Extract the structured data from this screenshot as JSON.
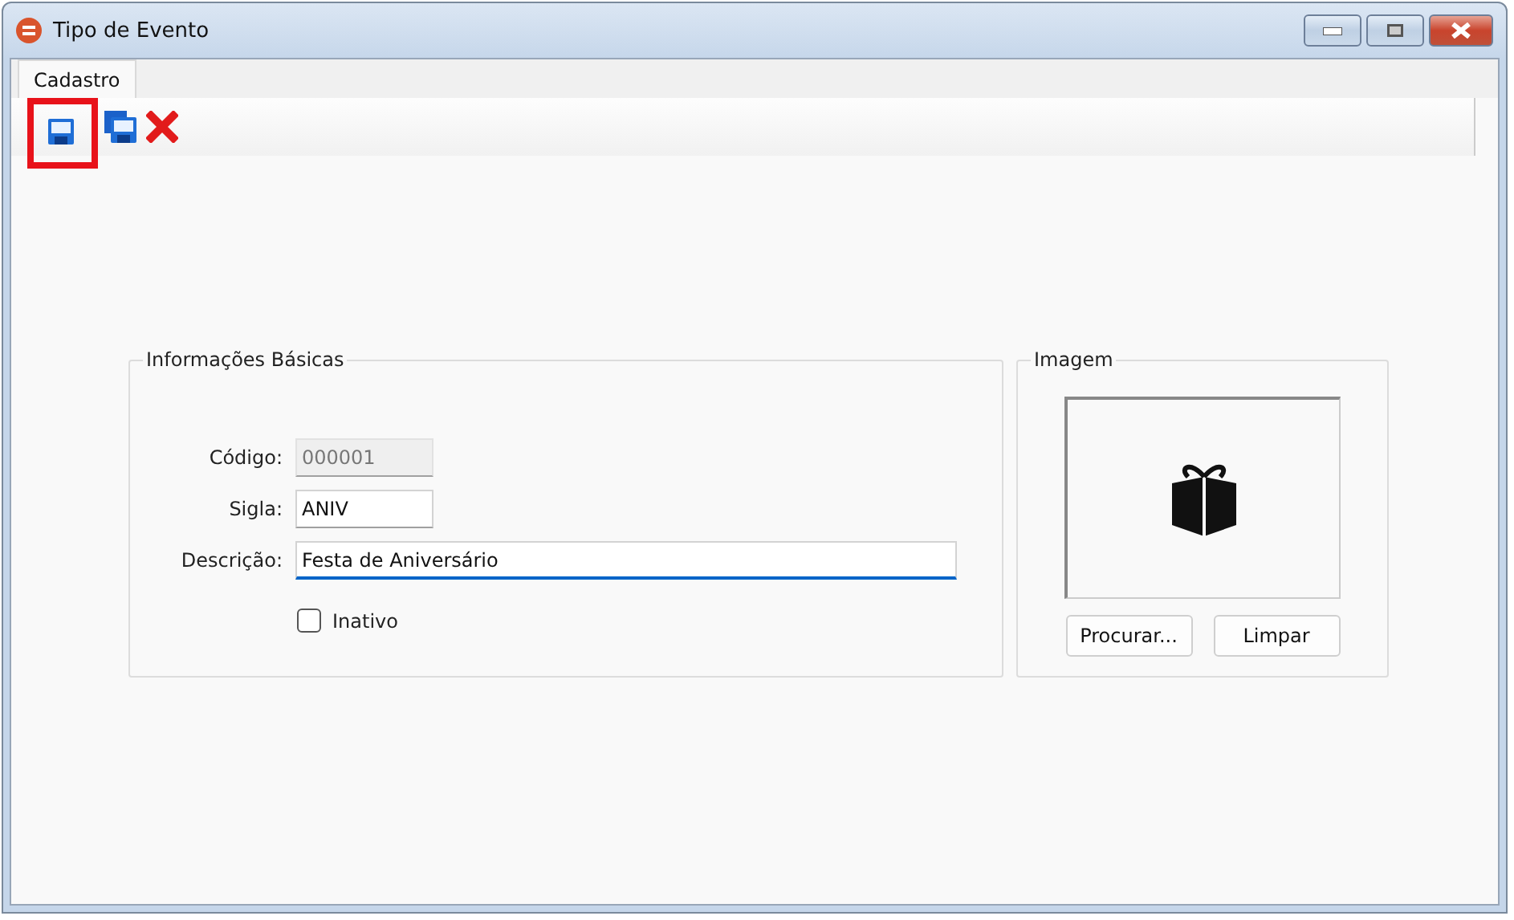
{
  "window": {
    "title": "Tipo de Evento"
  },
  "tabs": [
    {
      "label": "Cadastro",
      "selected": true
    }
  ],
  "toolbar": [
    {
      "kind": "save",
      "highlighted": true
    },
    {
      "kind": "save-copy",
      "highlighted": false
    },
    {
      "kind": "delete",
      "highlighted": false
    }
  ],
  "basic_info": {
    "title": "Informações Básicas",
    "fields": [
      {
        "label": "Código:",
        "value": "000001",
        "disabled": true,
        "kind": "short",
        "focused": false
      },
      {
        "label": "Sigla:",
        "value": "ANIV",
        "disabled": false,
        "kind": "short",
        "focused": false
      },
      {
        "label": "Descrição:",
        "value": "Festa de Aniversário",
        "disabled": false,
        "kind": "long",
        "focused": true
      }
    ],
    "checkbox": {
      "label": "Inativo",
      "checked": false
    }
  },
  "image_panel": {
    "title": "Imagem",
    "buttons": [
      "Procurar...",
      "Limpar"
    ]
  }
}
